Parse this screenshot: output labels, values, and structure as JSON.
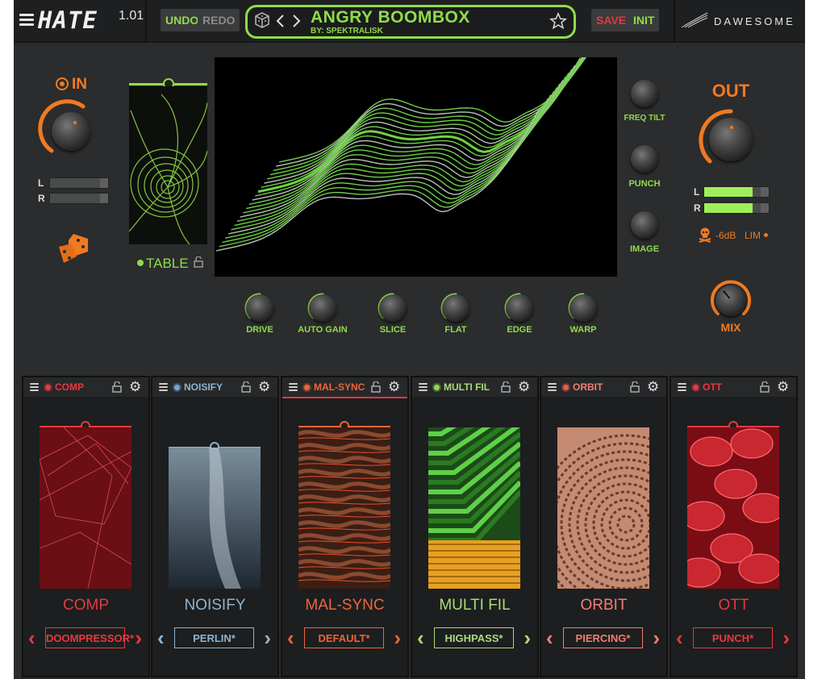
{
  "header": {
    "app_name": "HATE",
    "version": "1.01",
    "undo_label": "UNDO",
    "redo_label": "REDO",
    "preset_name": "ANGRY BOOMBOX",
    "preset_author": "BY: SPEKTRALISK",
    "save_label": "SAVE",
    "init_label": "INIT",
    "brand": "DAWESOME"
  },
  "input": {
    "label": "IN",
    "meter_l": "L",
    "meter_r": "R"
  },
  "table": {
    "label": "TABLE"
  },
  "side_knobs": [
    {
      "label": "FREQ TILT"
    },
    {
      "label": "PUNCH"
    },
    {
      "label": "IMAGE"
    }
  ],
  "output": {
    "label": "OUT",
    "meter_l": "L",
    "meter_r": "R",
    "meter_l_level": 0.75,
    "meter_r_level": 0.75,
    "limiter_db": "-6dB",
    "limiter_label": "LIM",
    "mix_label": "MIX"
  },
  "bottom_knobs": [
    {
      "label": "DRIVE"
    },
    {
      "label": "AUTO GAIN"
    },
    {
      "label": "SLICE"
    },
    {
      "label": "FLAT"
    },
    {
      "label": "EDGE"
    },
    {
      "label": "WARP"
    }
  ],
  "modules": [
    {
      "tab": "COMP",
      "name": "COMP",
      "preset": "DOOMPRESSOR*",
      "color": "#e8383f",
      "dot": "#e8383f"
    },
    {
      "tab": "NOISIFY",
      "name": "NOISIFY",
      "preset": "PERLIN*",
      "color": "#8fb4cf",
      "dot": "#6fa6d8"
    },
    {
      "tab": "MAL-SYNC",
      "name": "MAL-SYNC",
      "preset": "DEFAULT*",
      "color": "#f0643a",
      "dot": "#f0643a"
    },
    {
      "tab": "MULTI FIL",
      "name": "MULTI FIL",
      "preset": "HIGHPASS*",
      "color": "#a8dc7a",
      "dot": "#8fdc4a"
    },
    {
      "tab": "ORBIT",
      "name": "ORBIT",
      "preset": "PIERCING*",
      "color": "#ef7f72",
      "dot": "#ef5a4a"
    },
    {
      "tab": "OTT",
      "name": "OTT",
      "preset": "PUNCH*",
      "color": "#e8383f",
      "dot": "#e8383f"
    }
  ]
}
